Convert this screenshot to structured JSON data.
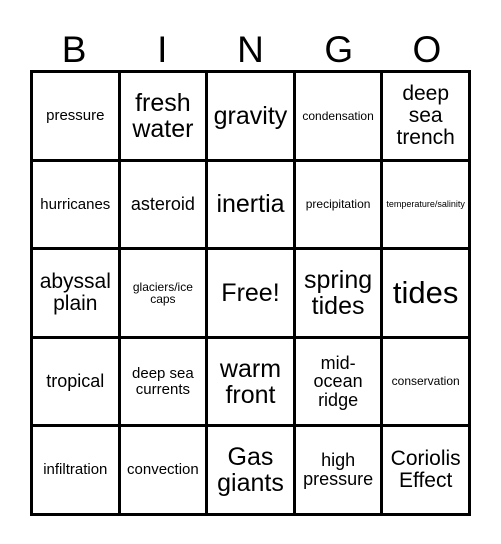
{
  "card": {
    "headers": [
      "B",
      "I",
      "N",
      "G",
      "O"
    ],
    "rows": [
      [
        {
          "text": "pressure",
          "size": "md"
        },
        {
          "text": "fresh water",
          "size": "xxl"
        },
        {
          "text": "gravity",
          "size": "xxl"
        },
        {
          "text": "condensation",
          "size": "sm"
        },
        {
          "text": "deep sea trench",
          "size": "xl"
        }
      ],
      [
        {
          "text": "hurricanes",
          "size": "md"
        },
        {
          "text": "asteroid",
          "size": "lg"
        },
        {
          "text": "inertia",
          "size": "xxl"
        },
        {
          "text": "precipitation",
          "size": "sm"
        },
        {
          "text": "temperature/salinity",
          "size": "xs"
        }
      ],
      [
        {
          "text": "abyssal plain",
          "size": "xl"
        },
        {
          "text": "glaciers/ice caps",
          "size": "sm"
        },
        {
          "text": "Free!",
          "size": "xxl"
        },
        {
          "text": "spring tides",
          "size": "xxl"
        },
        {
          "text": "tides",
          "size": "huge"
        }
      ],
      [
        {
          "text": "tropical",
          "size": "lg"
        },
        {
          "text": "deep sea currents",
          "size": "md"
        },
        {
          "text": "warm front",
          "size": "xxl"
        },
        {
          "text": "mid-ocean ridge",
          "size": "lg"
        },
        {
          "text": "conservation",
          "size": "sm"
        }
      ],
      [
        {
          "text": "infiltration",
          "size": "md"
        },
        {
          "text": "convection",
          "size": "md"
        },
        {
          "text": "Gas giants",
          "size": "xxl"
        },
        {
          "text": "high pressure",
          "size": "lg"
        },
        {
          "text": "Coriolis Effect",
          "size": "xl"
        }
      ]
    ]
  },
  "colors": {
    "ink": "#000000",
    "paper": "#ffffff"
  }
}
